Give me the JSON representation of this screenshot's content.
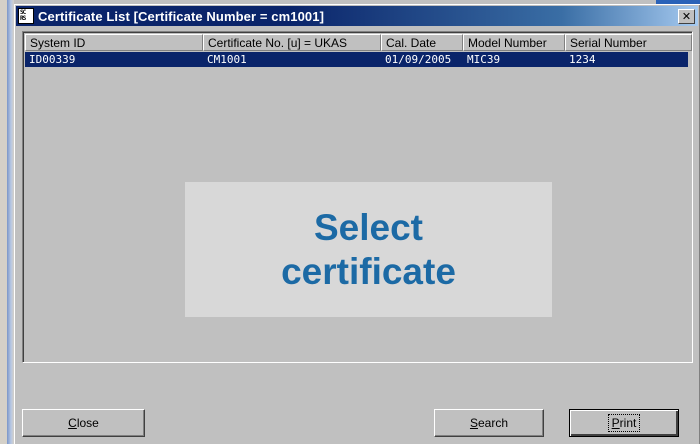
{
  "window": {
    "title": "Certificate List [Certificate Number = cm1001]",
    "icon_text": "SCA\nRST",
    "close_glyph": "✕"
  },
  "list": {
    "columns": [
      "System ID",
      "Certificate No. [u] = UKAS",
      "Cal. Date",
      "Model Number",
      "Serial Number"
    ],
    "rows": [
      [
        "ID00339",
        "CM1001",
        "01/09/2005",
        "MIC39",
        "1234"
      ]
    ],
    "selected_row": 0
  },
  "overlay": {
    "line1": "Select",
    "line2": "certificate"
  },
  "buttons": {
    "close": {
      "prefix": "",
      "mnemonic": "C",
      "rest": "lose"
    },
    "search": {
      "prefix": "",
      "mnemonic": "S",
      "rest": "earch"
    },
    "print": {
      "prefix": "",
      "mnemonic": "P",
      "rest": "rint"
    }
  },
  "colors": {
    "selection": "#0a246a",
    "overlay_text": "#1c6aa5",
    "titlebar": "#0a246a"
  }
}
